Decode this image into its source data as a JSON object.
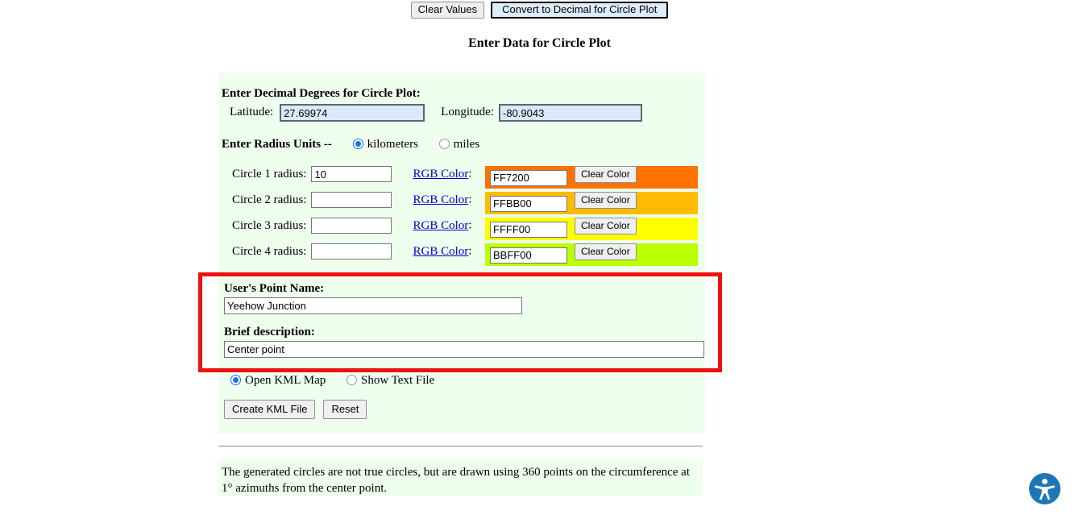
{
  "toolbar": {
    "clear_values_label": "Clear Values",
    "convert_label": "Convert to Decimal for Circle Plot"
  },
  "page_title": "Enter Data for Circle Plot",
  "coordinates": {
    "heading": "Enter Decimal Degrees for Circle Plot:",
    "latitude_label": "Latitude:",
    "latitude_value": "27.69974",
    "longitude_label": "Longitude:",
    "longitude_value": "-80.9043"
  },
  "units": {
    "heading": "Enter Radius Units --",
    "options": [
      {
        "label": "kilometers",
        "selected": true
      },
      {
        "label": "miles",
        "selected": false
      }
    ]
  },
  "circles": {
    "rgb_link_label": "RGB Color",
    "colon": ":",
    "clear_color_label": "Clear Color",
    "rows": [
      {
        "label": "Circle 1 radius:",
        "radius": "10",
        "hex": "FF7200",
        "swatch_color": "#FF7200"
      },
      {
        "label": "Circle 2 radius:",
        "radius": "",
        "hex": "FFBB00",
        "swatch_color": "#FFBB00"
      },
      {
        "label": "Circle 3 radius:",
        "radius": "",
        "hex": "FFFF00",
        "swatch_color": "#FFFF00"
      },
      {
        "label": "Circle 4 radius:",
        "radius": "",
        "hex": "BBFF00",
        "swatch_color": "#BBFF00"
      }
    ]
  },
  "user_point": {
    "name_heading": "User's Point Name:",
    "name_value": "Yeehow Junction",
    "description_heading": "Brief description:",
    "description_value": "Center point"
  },
  "output": {
    "options": [
      {
        "label": "Open KML Map",
        "selected": true
      },
      {
        "label": "Show Text File",
        "selected": false
      }
    ],
    "create_label": "Create KML File",
    "reset_label": "Reset"
  },
  "footer": {
    "note": "The generated circles are not true circles, but are drawn using 360 points on the circumference at 1° azimuths from the center point."
  },
  "accessibility": {
    "icon_title": "Accessibility options"
  },
  "colors": {
    "panel_background": "#EEFFEE",
    "input_highlight": "#DBE9FB",
    "annotation_red": "#EE1111",
    "link_blue": "#0000CC",
    "a11y_blue": "#1D76B5"
  }
}
